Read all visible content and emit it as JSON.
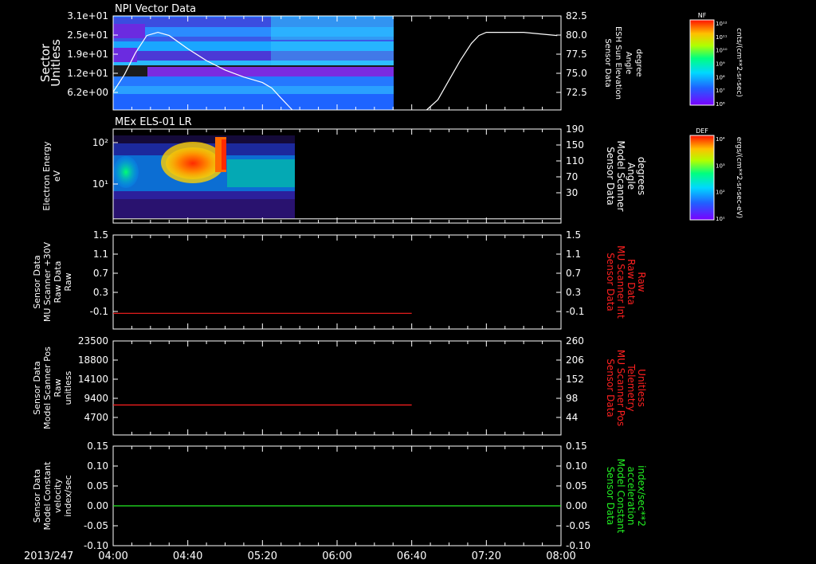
{
  "date_label": "2013/247",
  "x_ticks": [
    "04:00",
    "04:40",
    "05:20",
    "06:00",
    "06:40",
    "07:20",
    "08:00"
  ],
  "colors": {
    "frame": "#ffffff",
    "red_trace": "#ff2020",
    "green_trace": "#22ee22",
    "red_label": "#ff2020",
    "green_label": "#22ee22"
  },
  "panels": [
    {
      "title": "NPI Vector Data",
      "left_label": [
        "Sector",
        "Unitless"
      ],
      "left_ticks": [
        "3.1e+01",
        "2.5e+01",
        "1.9e+01",
        "1.2e+01",
        "6.2e+00"
      ],
      "right_label": [
        "Sensor Data",
        "ESH Sun Elevation",
        "Angle",
        "degree"
      ],
      "right_ticks": [
        "82.5",
        "80.0",
        "77.5",
        "75.0",
        "72.5"
      ]
    },
    {
      "title": "MEx ELS-01 LR",
      "left_label": [
        "Electron Energy",
        "eV"
      ],
      "left_ticks": [
        "10²",
        "10¹"
      ],
      "right_label": [
        "Sensor Data",
        "Model Scanner",
        "Angle",
        "degrees"
      ],
      "right_ticks": [
        "190",
        "150",
        "110",
        "70",
        "30"
      ]
    },
    {
      "title": "",
      "left_label": [
        "Sensor Data",
        "MU Scanner +30V",
        "Raw Data",
        "Raw"
      ],
      "left_ticks": [
        "1.5",
        "1.1",
        "0.7",
        "0.3",
        "-0.1"
      ],
      "right_label": [
        "Sensor Data",
        "MU Scanner Int",
        "Raw Data",
        "Raw"
      ],
      "right_ticks": [
        "1.5",
        "1.1",
        "0.7",
        "0.3",
        "-0.1"
      ]
    },
    {
      "title": "",
      "left_label": [
        "Sensor Data",
        "Model Scanner Pos",
        "Raw",
        "unitless"
      ],
      "left_ticks": [
        "23500",
        "18800",
        "14100",
        "9400",
        "4700"
      ],
      "right_label": [
        "Sensor Data",
        "MU Scanner Pos",
        "Telemetry",
        "Unitless"
      ],
      "right_ticks": [
        "260",
        "206",
        "152",
        "98",
        "44"
      ]
    },
    {
      "title": "",
      "left_label": [
        "Sensor Data",
        "Model Constant",
        "velocity",
        "index/sec"
      ],
      "left_ticks": [
        "0.15",
        "0.10",
        "0.05",
        "0.00",
        "-0.05",
        "-0.10"
      ],
      "right_label": [
        "Sensor Data",
        "Model Constant",
        "acceleration",
        "index/sec**2"
      ],
      "right_ticks": [
        "0.15",
        "0.10",
        "0.05",
        "0.00",
        "-0.05",
        "-0.10"
      ]
    }
  ],
  "colorbars": [
    {
      "label": "NF",
      "unit": "cnts/(cm**2-sr-sec)",
      "ticks": [
        "10¹²",
        "10¹¹",
        "10¹⁰",
        "10⁹",
        "10⁸",
        "10⁷",
        "10⁶"
      ]
    },
    {
      "label": "DEF",
      "unit": "ergs/(cm**2-sr-sec-eV)",
      "ticks": [
        "10⁴",
        "10³",
        "10²",
        "10¹"
      ]
    }
  ],
  "chart_data": [
    {
      "type": "heatmap",
      "title": "NPI Vector Data",
      "x_range": [
        "04:00",
        "08:00"
      ],
      "data_extent": [
        "04:00",
        "06:35"
      ],
      "ylabel": "Sector Unitless",
      "ylim": [
        0,
        31
      ],
      "line_series": {
        "name": "ESH Sun Elevation Angle",
        "unit": "degree",
        "ylim": [
          70.5,
          82.5
        ],
        "x": [
          "04:00",
          "04:06",
          "04:12",
          "04:18",
          "04:24",
          "04:30",
          "04:40",
          "04:50",
          "05:00",
          "05:10",
          "05:20",
          "05:25",
          "05:30",
          "05:36",
          "06:48",
          "06:54",
          "07:00",
          "07:06",
          "07:12",
          "07:16",
          "07:20",
          "07:40",
          "07:58"
        ],
        "values": [
          72.8,
          75.0,
          77.8,
          80.0,
          80.4,
          80.0,
          78.3,
          76.8,
          75.6,
          74.7,
          74.0,
          73.3,
          72.0,
          70.5,
          70.5,
          71.8,
          74.3,
          76.8,
          79.0,
          80.0,
          80.4,
          80.4,
          80.0
        ]
      }
    },
    {
      "type": "heatmap",
      "title": "MEx ELS-01 LR",
      "x_range": [
        "04:00",
        "08:00"
      ],
      "data_extent": [
        "04:00",
        "05:37"
      ],
      "ylabel": "Electron Energy eV",
      "scale": "log",
      "peak_intensity_interval": [
        "04:27",
        "04:52"
      ],
      "line_series": {
        "name": "Model Scanner Angle",
        "unit": "degrees",
        "ylim": [
          10,
          190
        ],
        "x": [
          "04:00",
          "08:00"
        ],
        "values": [
          12,
          12
        ]
      }
    },
    {
      "type": "line",
      "x_range": [
        "04:00",
        "08:00"
      ],
      "ylim": [
        -0.3,
        1.5
      ],
      "series": [
        {
          "name": "MU Scanner +30V Raw Data",
          "x": [
            "04:00",
            "06:40"
          ],
          "values": [
            0.0,
            0.0
          ]
        }
      ]
    },
    {
      "type": "line",
      "x_range": [
        "04:00",
        "08:00"
      ],
      "ylim": [
        0,
        23500
      ],
      "series": [
        {
          "name": "Model Scanner Pos Raw",
          "x": [
            "04:00",
            "06:40"
          ],
          "values": [
            7500,
            7500
          ]
        }
      ]
    },
    {
      "type": "line",
      "x_range": [
        "04:00",
        "08:00"
      ],
      "ylim": [
        -0.1,
        0.15
      ],
      "series": [
        {
          "name": "Model Constant velocity",
          "x": [
            "04:00",
            "08:00"
          ],
          "values": [
            0.0,
            0.0
          ]
        }
      ]
    }
  ]
}
